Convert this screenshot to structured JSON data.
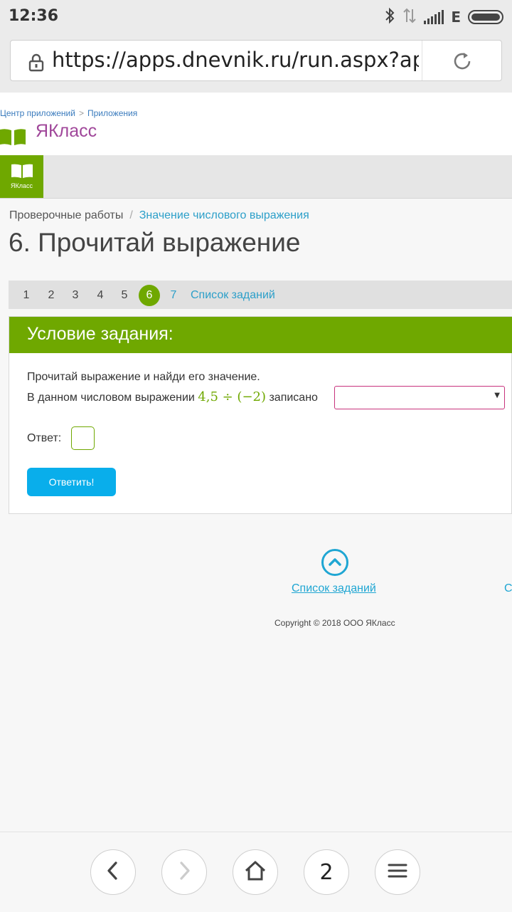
{
  "status_bar": {
    "time": "12:36",
    "network_label": "E"
  },
  "browser": {
    "url": "https://apps.dnevnik.ru/run.aspx?app"
  },
  "header": {
    "crumbs": [
      "Центр приложений",
      "Приложения"
    ],
    "crumb_separator": ">",
    "brand": "ЯКласс",
    "nav_logo_label": "ЯКласс"
  },
  "page": {
    "breadcrumb": [
      "Проверочные работы",
      "Значение числового выражения"
    ],
    "breadcrumb_separator": "/",
    "title": "6. Прочитай выражение"
  },
  "pager": {
    "pages": [
      "1",
      "2",
      "3",
      "4",
      "5",
      "6",
      "7"
    ],
    "active_page": "6",
    "list_link": "Список заданий"
  },
  "task": {
    "heading": "Условие задания:",
    "instruction": "Прочитай выражение и найди его значение.",
    "sentence_prefix": "В данном числовом выражении",
    "expression": "4,5 ÷ (−2)",
    "sentence_suffix": "записано",
    "select_value": "",
    "answer_label": "Ответ:",
    "answer_value": "",
    "submit_label": "Ответить!"
  },
  "footer": {
    "list_link": "Список заданий",
    "next_link_partial": "С",
    "copyright": "Copyright © 2018 ООО ЯКласс"
  },
  "bottom_nav": {
    "tab_count": "2"
  },
  "colors": {
    "brand_green": "#6fa800",
    "brand_purple": "#a0479a",
    "link_blue": "#2c9fc9",
    "button_blue": "#09aeeb",
    "select_border": "#c8337d"
  }
}
